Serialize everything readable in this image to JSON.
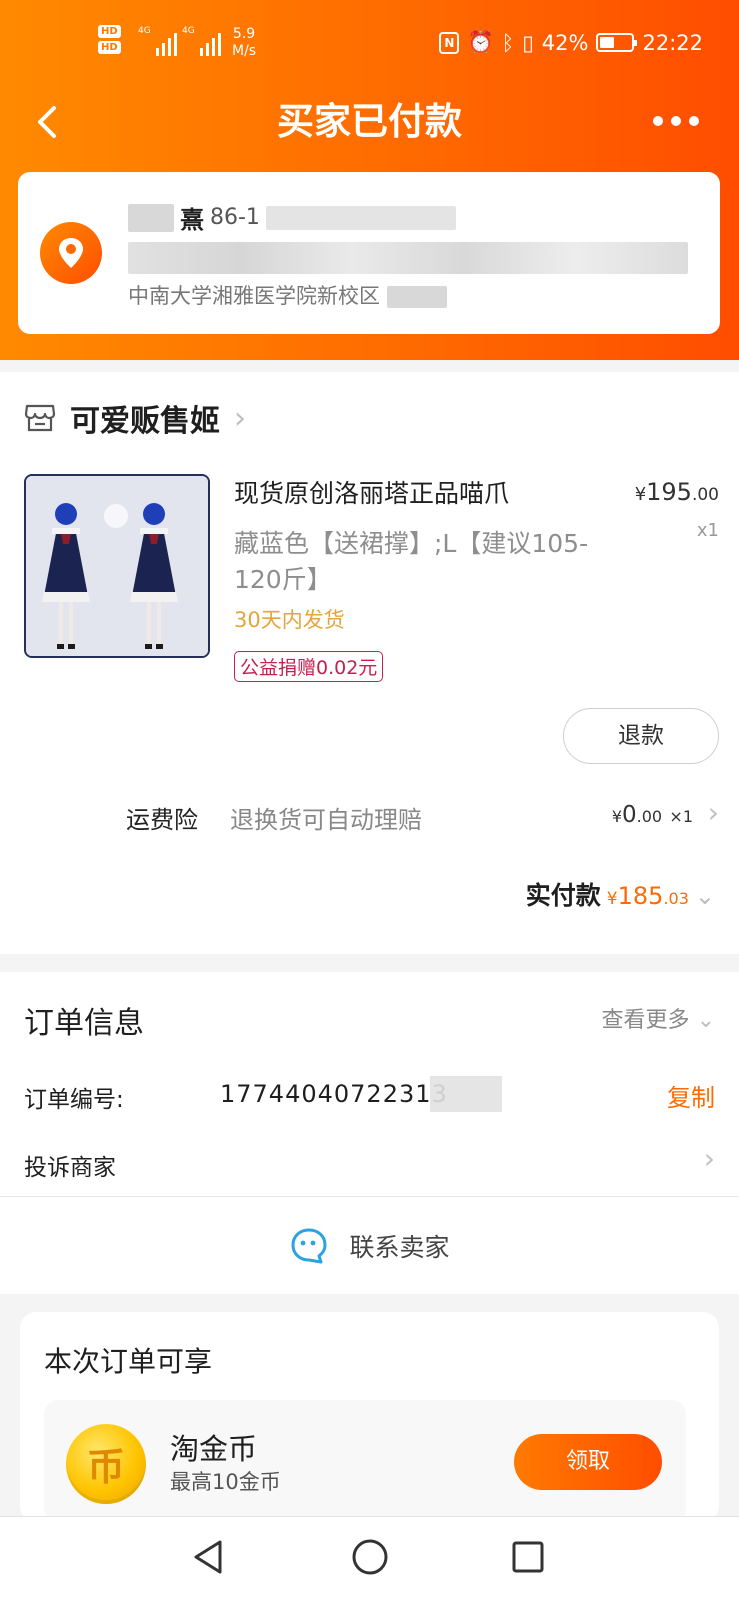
{
  "status_bar": {
    "hd1": "HD",
    "hd2": "HD",
    "sim1_net": "4G",
    "sim2_net": "4G",
    "speed_value": "5.9",
    "speed_unit": "M/s",
    "battery": "42%",
    "time": "22:22"
  },
  "nav": {
    "title": "买家已付款"
  },
  "address": {
    "name_visible": "熹",
    "phone_prefix": "86-1",
    "line3": "中南大学湘雅医学院新校区"
  },
  "shop": {
    "name": "可爱贩售姬"
  },
  "product": {
    "title": "现货原创洛丽塔正品喵爪",
    "price_main": "195",
    "price_decimal": ".00",
    "currency": "¥",
    "qty": "x1",
    "spec": "藏蓝色【送裙撑】;L【建议105-120斤】",
    "shipping": "30天内发货",
    "charity": "公益捐赠0.02元",
    "refund_label": "退款"
  },
  "insurance": {
    "label": "运费险",
    "desc": "退换货可自动理赔",
    "currency": "¥",
    "price_main": "0",
    "price_decimal": ".00",
    "qty": "×1"
  },
  "paid": {
    "label": "实付款",
    "currency": "¥",
    "amount_main": "185",
    "amount_decimal": ".03"
  },
  "order_info": {
    "title": "订单信息",
    "more_label": "查看更多",
    "order_no_label": "订单编号:",
    "order_no": "17744040722313",
    "copy_label": "复制",
    "complain_label": "投诉商家",
    "contact_label": "联系卖家"
  },
  "benefits": {
    "title": "本次订单可享",
    "coin_glyph": "币",
    "coin_name": "淘金币",
    "coin_sub": "最高10金币",
    "claim_label": "领取"
  },
  "colors": {
    "brand_orange": "#ff6a00",
    "charity_red": "#c4214f",
    "shipping_yellow": "#e5a53a"
  }
}
